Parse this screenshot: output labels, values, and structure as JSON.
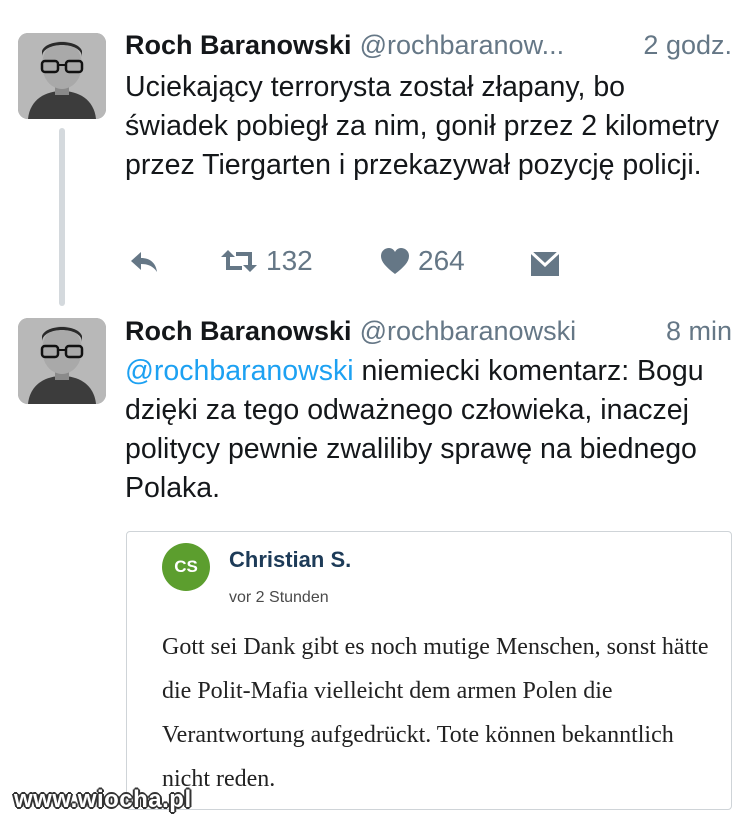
{
  "tweets": [
    {
      "author_name": "Roch Baranowski",
      "handle": "@rochbaranow...",
      "time": "2 godz.",
      "text": "Uciekający terrorysta został złapany, bo świadek pobiegł za nim, gonił przez 2 kilometry przez Tiergarten i przekazywał pozycję policji.",
      "retweet_count": "132",
      "like_count": "264"
    },
    {
      "author_name": "Roch Baranowski",
      "handle": "@rochbaranowski",
      "time": "8 min",
      "mention": "@rochbaranowski",
      "text": " niemiecki komentarz: Bogu dzięki za tego odważnego człowieka, inaczej politycy pewnie zwaliliby sprawę na biednego Polaka."
    }
  ],
  "quoted_comment": {
    "initials": "CS",
    "author": "Christian S.",
    "time": "vor 2 Stunden",
    "text": "Gott sei Dank gibt es noch mutige Menschen, sonst hätte die Polit-Mafia vielleicht dem armen Polen die Verantwortung aufgedrückt. Tote können bekanntlich nicht reden."
  },
  "watermark": "www.wiocha.pl",
  "icons": [
    "reply-icon",
    "retweet-icon",
    "heart-icon",
    "direct-message-icon"
  ],
  "colors": {
    "link": "#1da1f2",
    "secondary": "#657786",
    "cs_avatar": "#5c9e2e",
    "cs_name": "#1d3b58"
  }
}
